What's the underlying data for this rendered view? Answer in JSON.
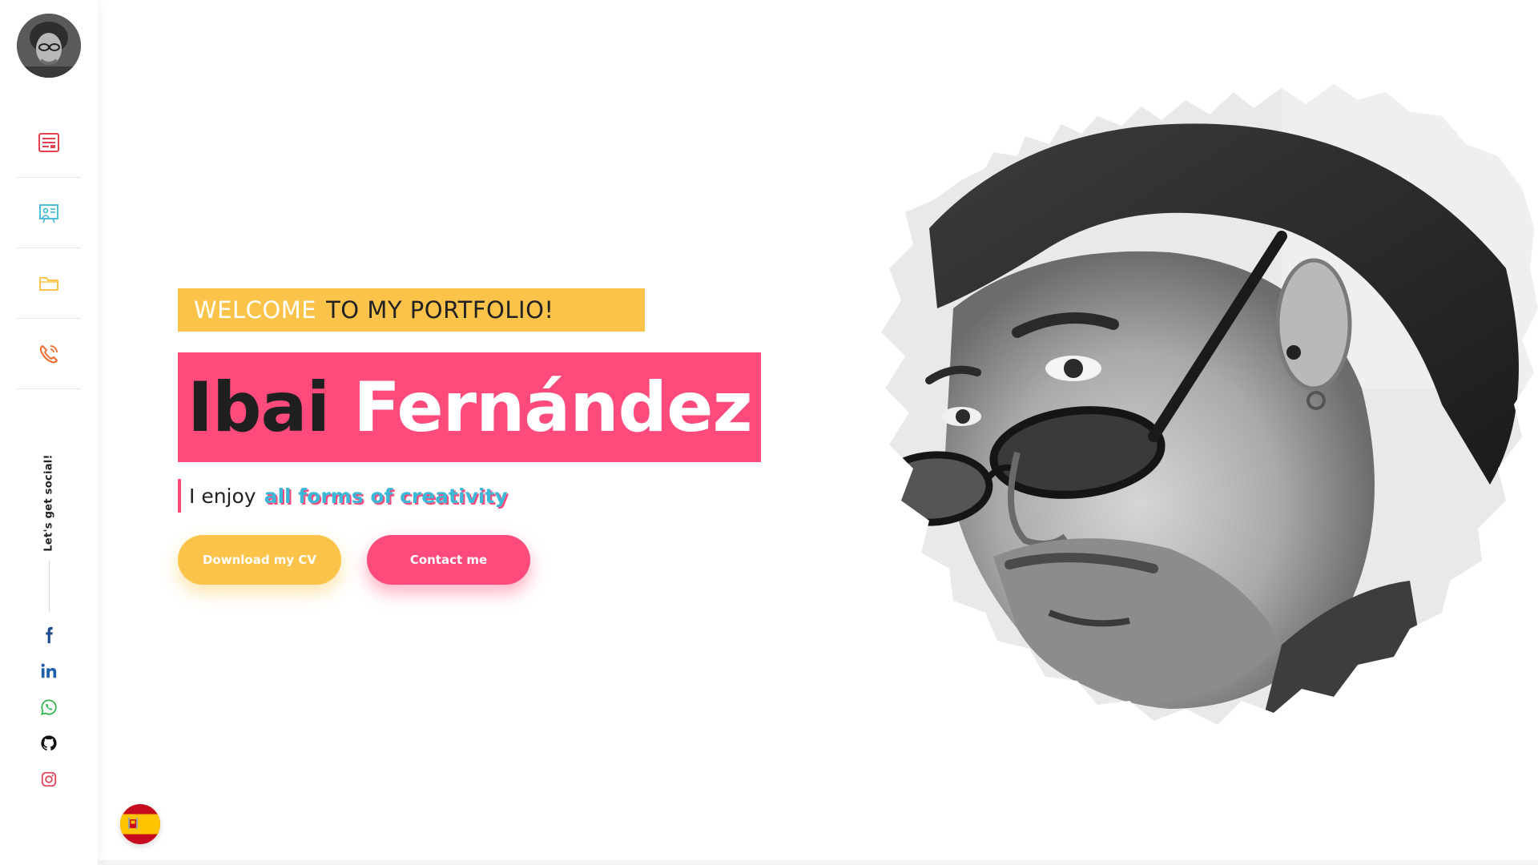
{
  "sidebar": {
    "avatar_alt": "profile-photo",
    "nav": [
      {
        "id": "about",
        "icon": "resume-icon",
        "color": "#e5404f"
      },
      {
        "id": "experience",
        "icon": "presentation-icon",
        "color": "#3cb8d6"
      },
      {
        "id": "portfolio",
        "icon": "folder-icon",
        "color": "#fbc34a"
      },
      {
        "id": "contact",
        "icon": "phone-icon",
        "color": "#f26b2c"
      }
    ],
    "social_label": "Let's get social!",
    "social": [
      {
        "network": "facebook",
        "icon": "facebook-icon",
        "color": "#1f4b8e"
      },
      {
        "network": "linkedin",
        "icon": "linkedin-icon",
        "color": "#1d5fa8"
      },
      {
        "network": "whatsapp",
        "icon": "whatsapp-icon",
        "color": "#27b148"
      },
      {
        "network": "github",
        "icon": "github-icon",
        "color": "#111111"
      },
      {
        "network": "instagram",
        "icon": "instagram-icon",
        "color": "#e0445b"
      }
    ]
  },
  "hero": {
    "welcome_highlight": "WELCOME",
    "welcome_rest": "TO MY PORTFOLIO!",
    "first_name": "Ibai",
    "last_name": "Fernández",
    "tagline_prefix": "I enjoy",
    "tagline_highlight": "all forms of creativity",
    "buttons": {
      "cv": "Download my CV",
      "contact": "Contact me"
    }
  },
  "language": {
    "current": "es",
    "icon": "spain-flag-icon"
  },
  "colors": {
    "pink": "#fe4b7b",
    "yellow": "#fbc34a",
    "cyan": "#3cb8d6",
    "dark": "#222222"
  }
}
